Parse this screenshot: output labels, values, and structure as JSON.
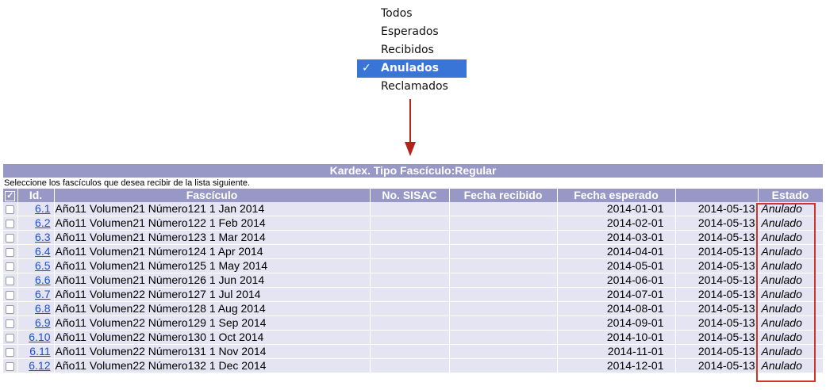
{
  "menu": {
    "items": [
      {
        "label": "Todos",
        "selected": false
      },
      {
        "label": "Esperados",
        "selected": false
      },
      {
        "label": "Recibidos",
        "selected": false
      },
      {
        "label": "Anulados",
        "selected": true
      },
      {
        "label": "Reclamados",
        "selected": false
      }
    ],
    "check_glyph": "✓"
  },
  "kardex": {
    "title": "Kardex. Tipo Fascículo:Regular",
    "instructions": "Seleccione los fascículos que desea recibir de la lista siguiente.",
    "columns": {
      "check_glyph": "✓",
      "id": "Id.",
      "fasciculo": "Fascículo",
      "sisac": "No. SISAC",
      "fecha_recibido": "Fecha recibido",
      "fecha_esperado": "Fecha esperado",
      "extra": "",
      "estado": "Estado"
    },
    "rows": [
      {
        "id": "6.1",
        "fasciculo": "Año11 Volumen21 Número121 1 Jan 2014",
        "sisac": "",
        "fecha_recibido": "",
        "fecha_esperado": "2014-01-01",
        "fecha_extra": "2014-05-13",
        "estado": "Anulado"
      },
      {
        "id": "6.2",
        "fasciculo": "Año11 Volumen21 Número122 1 Feb 2014",
        "sisac": "",
        "fecha_recibido": "",
        "fecha_esperado": "2014-02-01",
        "fecha_extra": "2014-05-13",
        "estado": "Anulado"
      },
      {
        "id": "6.3",
        "fasciculo": "Año11 Volumen21 Número123 1 Mar 2014",
        "sisac": "",
        "fecha_recibido": "",
        "fecha_esperado": "2014-03-01",
        "fecha_extra": "2014-05-13",
        "estado": "Anulado"
      },
      {
        "id": "6.4",
        "fasciculo": "Año11 Volumen21 Número124 1 Apr 2014",
        "sisac": "",
        "fecha_recibido": "",
        "fecha_esperado": "2014-04-01",
        "fecha_extra": "2014-05-13",
        "estado": "Anulado"
      },
      {
        "id": "6.5",
        "fasciculo": "Año11 Volumen21 Número125 1 May 2014",
        "sisac": "",
        "fecha_recibido": "",
        "fecha_esperado": "2014-05-01",
        "fecha_extra": "2014-05-13",
        "estado": "Anulado"
      },
      {
        "id": "6.6",
        "fasciculo": "Año11 Volumen21 Número126 1 Jun 2014",
        "sisac": "",
        "fecha_recibido": "",
        "fecha_esperado": "2014-06-01",
        "fecha_extra": "2014-05-13",
        "estado": "Anulado"
      },
      {
        "id": "6.7",
        "fasciculo": "Año11 Volumen22 Número127 1 Jul 2014",
        "sisac": "",
        "fecha_recibido": "",
        "fecha_esperado": "2014-07-01",
        "fecha_extra": "2014-05-13",
        "estado": "Anulado"
      },
      {
        "id": "6.8",
        "fasciculo": "Año11 Volumen22 Número128 1 Aug 2014",
        "sisac": "",
        "fecha_recibido": "",
        "fecha_esperado": "2014-08-01",
        "fecha_extra": "2014-05-13",
        "estado": "Anulado"
      },
      {
        "id": "6.9",
        "fasciculo": "Año11 Volumen22 Número129 1 Sep 2014",
        "sisac": "",
        "fecha_recibido": "",
        "fecha_esperado": "2014-09-01",
        "fecha_extra": "2014-05-13",
        "estado": "Anulado"
      },
      {
        "id": "6.10",
        "fasciculo": "Año11 Volumen22 Número130 1 Oct 2014",
        "sisac": "",
        "fecha_recibido": "",
        "fecha_esperado": "2014-10-01",
        "fecha_extra": "2014-05-13",
        "estado": "Anulado"
      },
      {
        "id": "6.11",
        "fasciculo": "Año11 Volumen22 Número131 1 Nov 2014",
        "sisac": "",
        "fecha_recibido": "",
        "fecha_esperado": "2014-11-01",
        "fecha_extra": "2014-05-13",
        "estado": "Anulado"
      },
      {
        "id": "6.12",
        "fasciculo": "Año11 Volumen22 Número132 1 Dec 2014",
        "sisac": "",
        "fecha_recibido": "",
        "fecha_esperado": "2014-12-01",
        "fecha_extra": "2014-05-13",
        "estado": "Anulado"
      }
    ]
  },
  "colors": {
    "header_bg": "#9898c6",
    "row_bg": "#e4e4f2",
    "link": "#1a4fd0",
    "menu_selected": "#3875d7",
    "arrow": "#b5221c",
    "highlight": "#d0342c"
  },
  "icons": [
    "check-icon",
    "down-arrow-icon",
    "header-checkbox-icon"
  ]
}
